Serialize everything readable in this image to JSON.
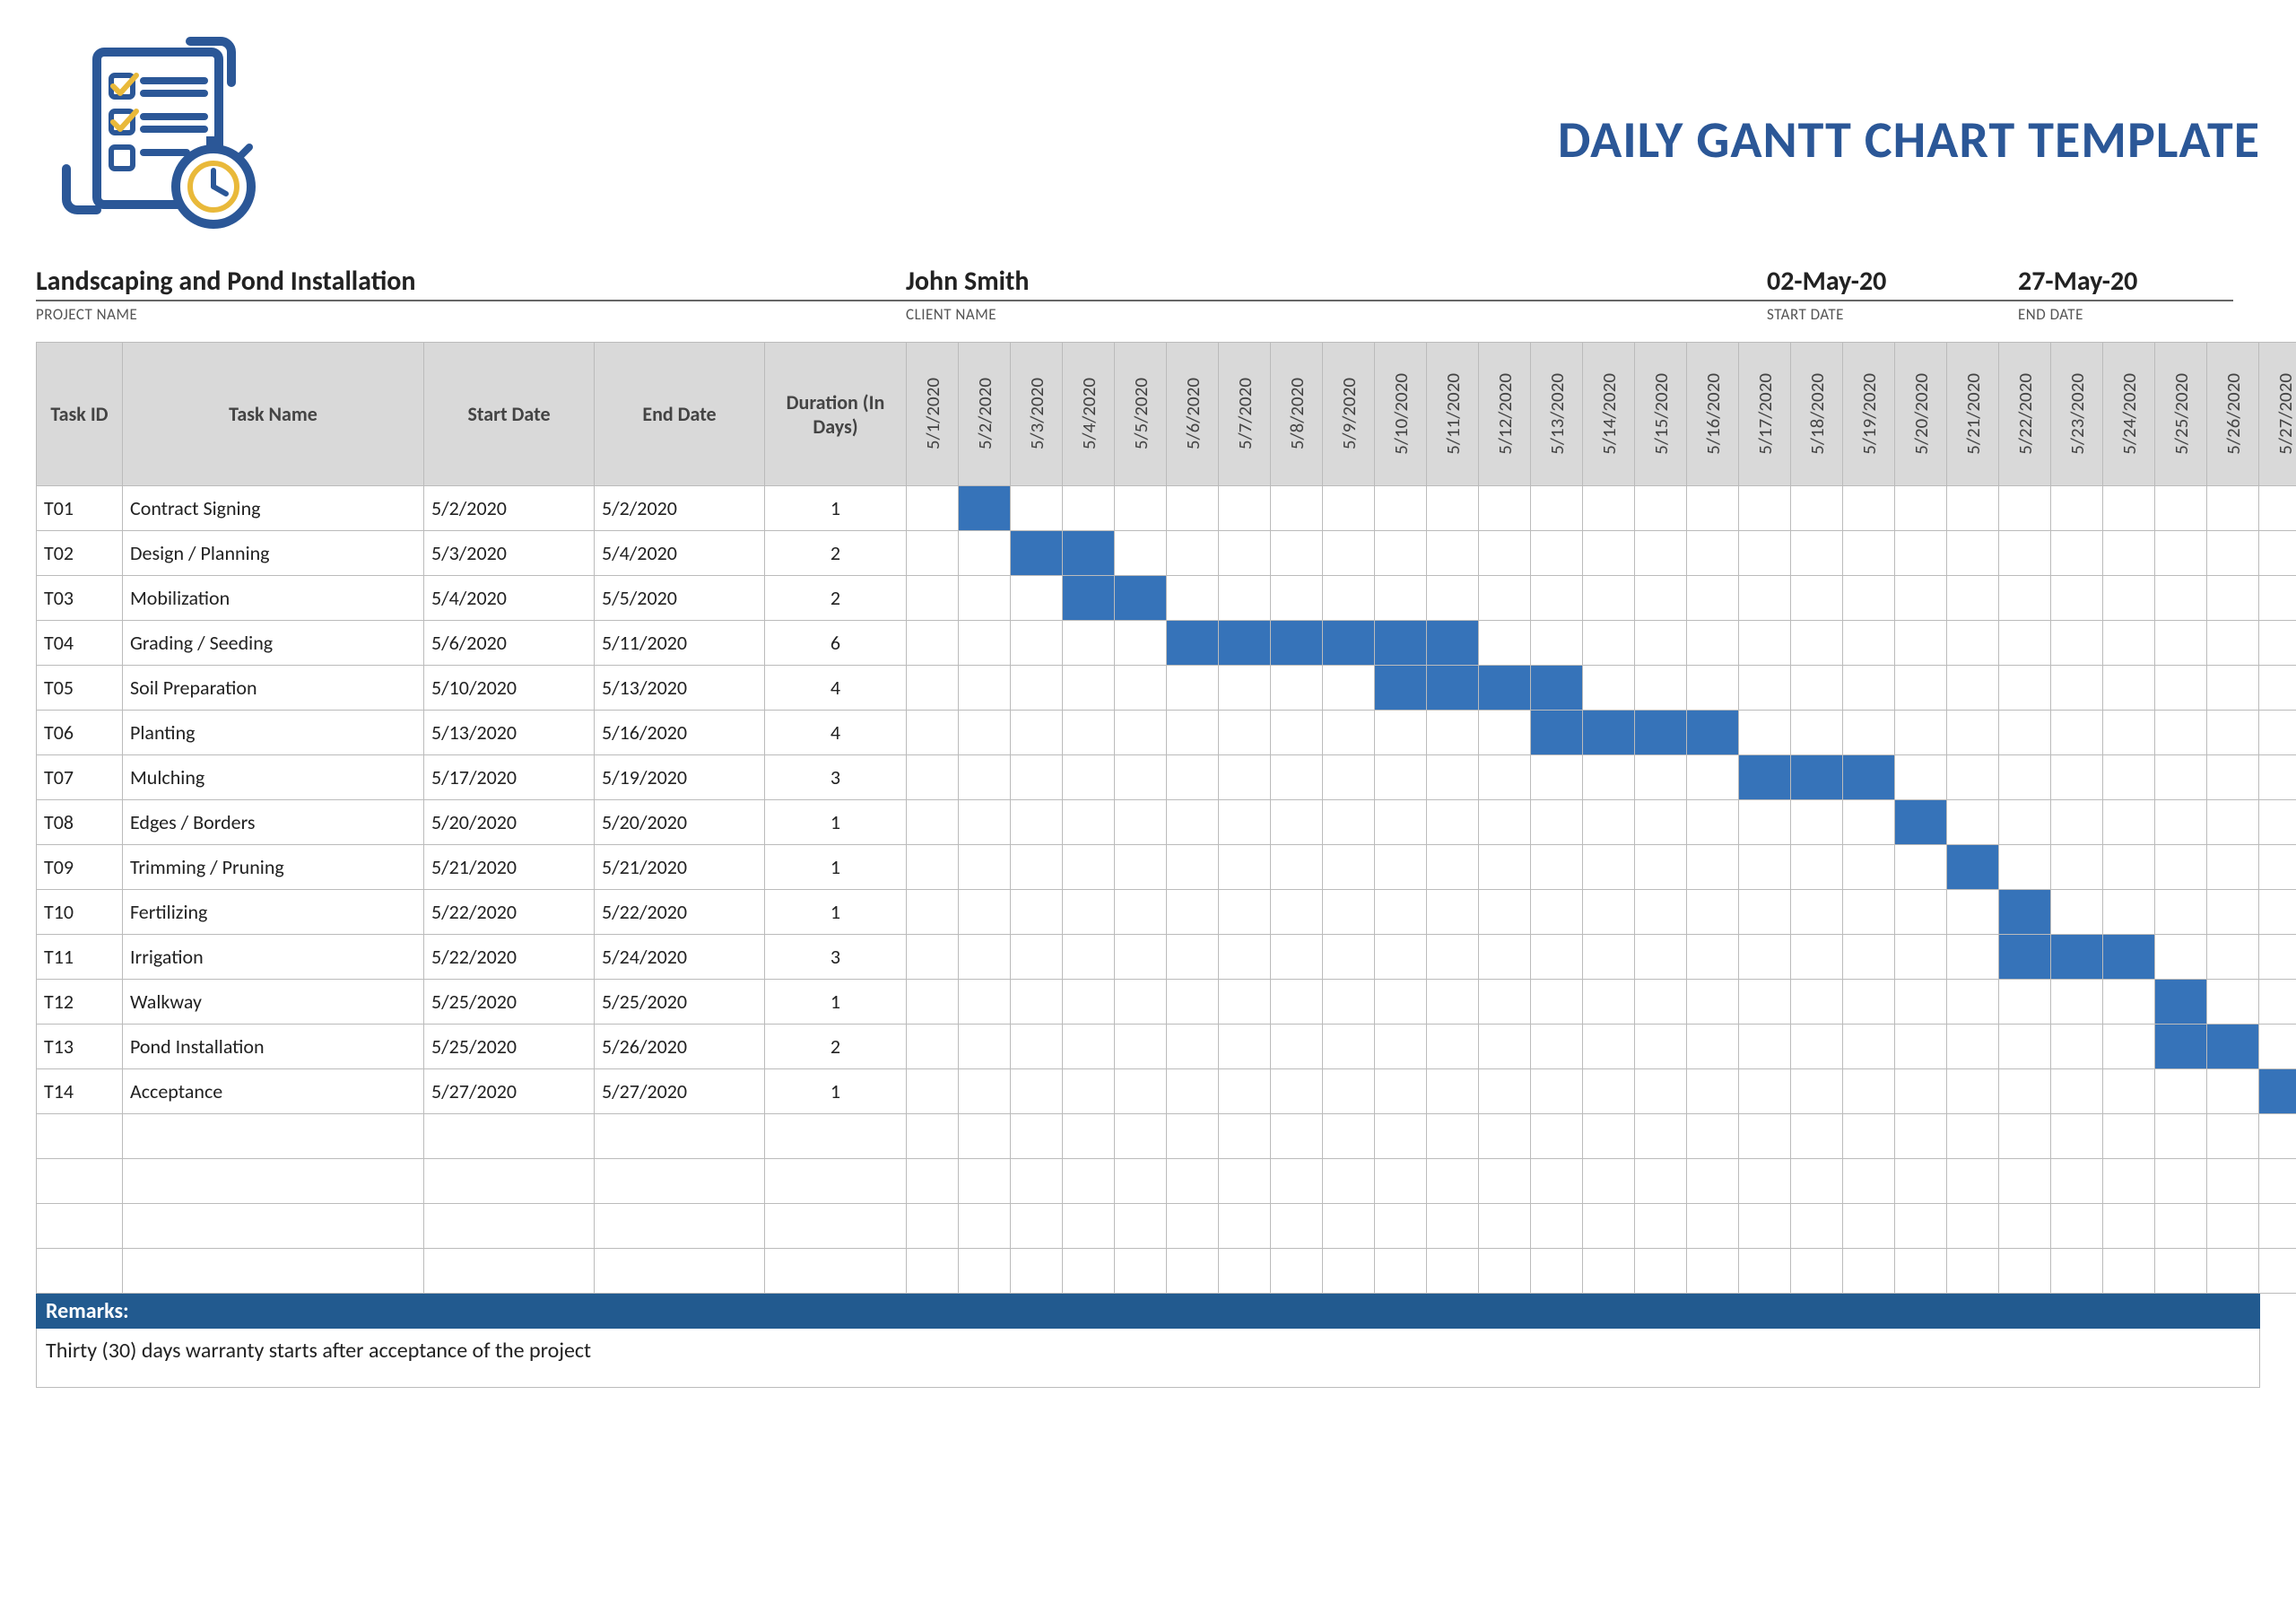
{
  "title": "DAILY GANTT CHART TEMPLATE",
  "meta": {
    "project_value": "Landscaping and Pond Installation",
    "project_label": "PROJECT NAME",
    "client_value": "John Smith",
    "client_label": "CLIENT NAME",
    "start_value": "02-May-20",
    "start_label": "START DATE",
    "end_value": "27-May-20",
    "end_label": "END DATE"
  },
  "columns": {
    "id": "Task ID",
    "name": "Task Name",
    "start": "Start Date",
    "end": "End Date",
    "duration": "Duration (In Days)"
  },
  "chart_data": {
    "type": "table",
    "dates": [
      "5/1/2020",
      "5/2/2020",
      "5/3/2020",
      "5/4/2020",
      "5/5/2020",
      "5/6/2020",
      "5/7/2020",
      "5/8/2020",
      "5/9/2020",
      "5/10/2020",
      "5/11/2020",
      "5/12/2020",
      "5/13/2020",
      "5/14/2020",
      "5/15/2020",
      "5/16/2020",
      "5/17/2020",
      "5/18/2020",
      "5/19/2020",
      "5/20/2020",
      "5/21/2020",
      "5/22/2020",
      "5/23/2020",
      "5/24/2020",
      "5/25/2020",
      "5/26/2020",
      "5/27/2020"
    ],
    "tasks": [
      {
        "id": "T01",
        "name": "Contract Signing",
        "start": "5/2/2020",
        "end": "5/2/2020",
        "duration": "1",
        "from": 2,
        "to": 2
      },
      {
        "id": "T02",
        "name": "Design / Planning",
        "start": "5/3/2020",
        "end": "5/4/2020",
        "duration": "2",
        "from": 3,
        "to": 4
      },
      {
        "id": "T03",
        "name": "Mobilization",
        "start": "5/4/2020",
        "end": "5/5/2020",
        "duration": "2",
        "from": 4,
        "to": 5
      },
      {
        "id": "T04",
        "name": "Grading / Seeding",
        "start": "5/6/2020",
        "end": "5/11/2020",
        "duration": "6",
        "from": 6,
        "to": 11
      },
      {
        "id": "T05",
        "name": "Soil Preparation",
        "start": "5/10/2020",
        "end": "5/13/2020",
        "duration": "4",
        "from": 10,
        "to": 13
      },
      {
        "id": "T06",
        "name": "Planting",
        "start": "5/13/2020",
        "end": "5/16/2020",
        "duration": "4",
        "from": 13,
        "to": 16
      },
      {
        "id": "T07",
        "name": "Mulching",
        "start": "5/17/2020",
        "end": "5/19/2020",
        "duration": "3",
        "from": 17,
        "to": 19
      },
      {
        "id": "T08",
        "name": "Edges / Borders",
        "start": "5/20/2020",
        "end": "5/20/2020",
        "duration": "1",
        "from": 20,
        "to": 20
      },
      {
        "id": "T09",
        "name": "Trimming / Pruning",
        "start": "5/21/2020",
        "end": "5/21/2020",
        "duration": "1",
        "from": 21,
        "to": 21
      },
      {
        "id": "T10",
        "name": "Fertilizing",
        "start": "5/22/2020",
        "end": "5/22/2020",
        "duration": "1",
        "from": 22,
        "to": 22
      },
      {
        "id": "T11",
        "name": "Irrigation",
        "start": "5/22/2020",
        "end": "5/24/2020",
        "duration": "3",
        "from": 22,
        "to": 24
      },
      {
        "id": "T12",
        "name": "Walkway",
        "start": "5/25/2020",
        "end": "5/25/2020",
        "duration": "1",
        "from": 25,
        "to": 25
      },
      {
        "id": "T13",
        "name": "Pond Installation",
        "start": "5/25/2020",
        "end": "5/26/2020",
        "duration": "2",
        "from": 25,
        "to": 26
      },
      {
        "id": "T14",
        "name": "Acceptance",
        "start": "5/27/2020",
        "end": "5/27/2020",
        "duration": "1",
        "from": 27,
        "to": 27
      }
    ],
    "empty_rows": 4
  },
  "remarks": {
    "label": "Remarks:",
    "text": "Thirty (30) days warranty starts after acceptance of the project"
  }
}
